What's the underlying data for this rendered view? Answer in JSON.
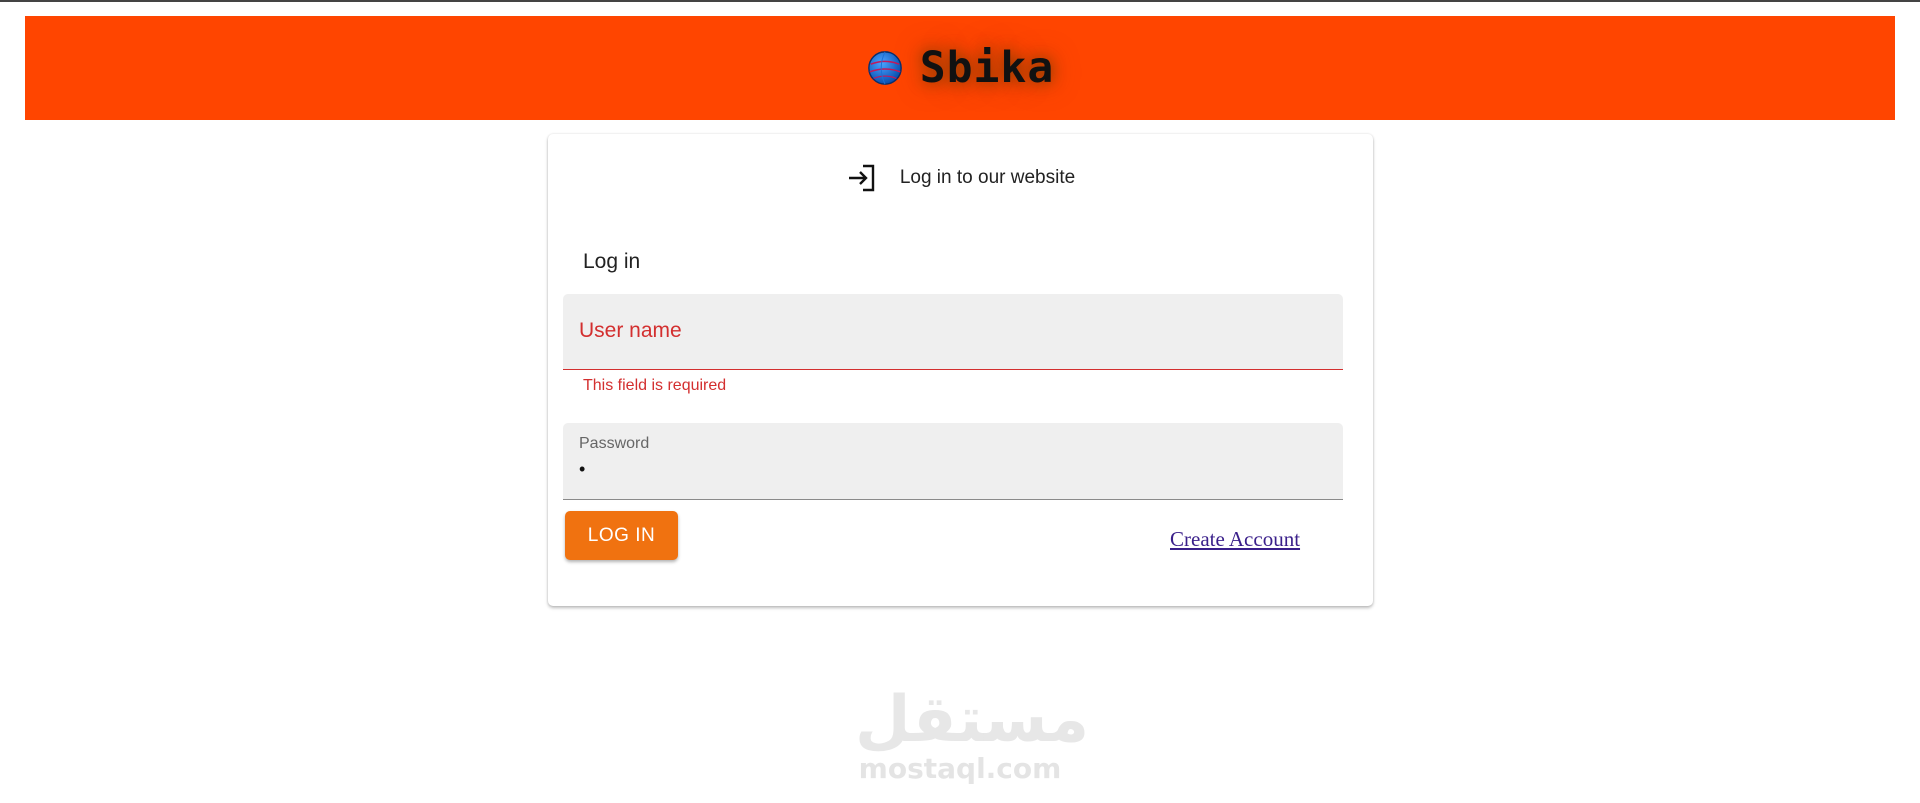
{
  "header": {
    "brand_name": "Sbika",
    "brand_icon": "globe-icon",
    "background_color": "#ff4500"
  },
  "card": {
    "subtitle": "Log in to our website",
    "subtitle_icon": "login-arrow-icon",
    "section_title": "Log in"
  },
  "form": {
    "username": {
      "placeholder": "User name",
      "error": "This field is required",
      "error_color": "#d32f2f"
    },
    "password": {
      "label": "Password",
      "value": "•"
    },
    "login_button": {
      "label": "LOG IN",
      "color": "#f07210"
    },
    "create_account_link": "Create Account"
  },
  "watermark": {
    "arabic": "مستقل",
    "latin": "mostaql.com"
  }
}
